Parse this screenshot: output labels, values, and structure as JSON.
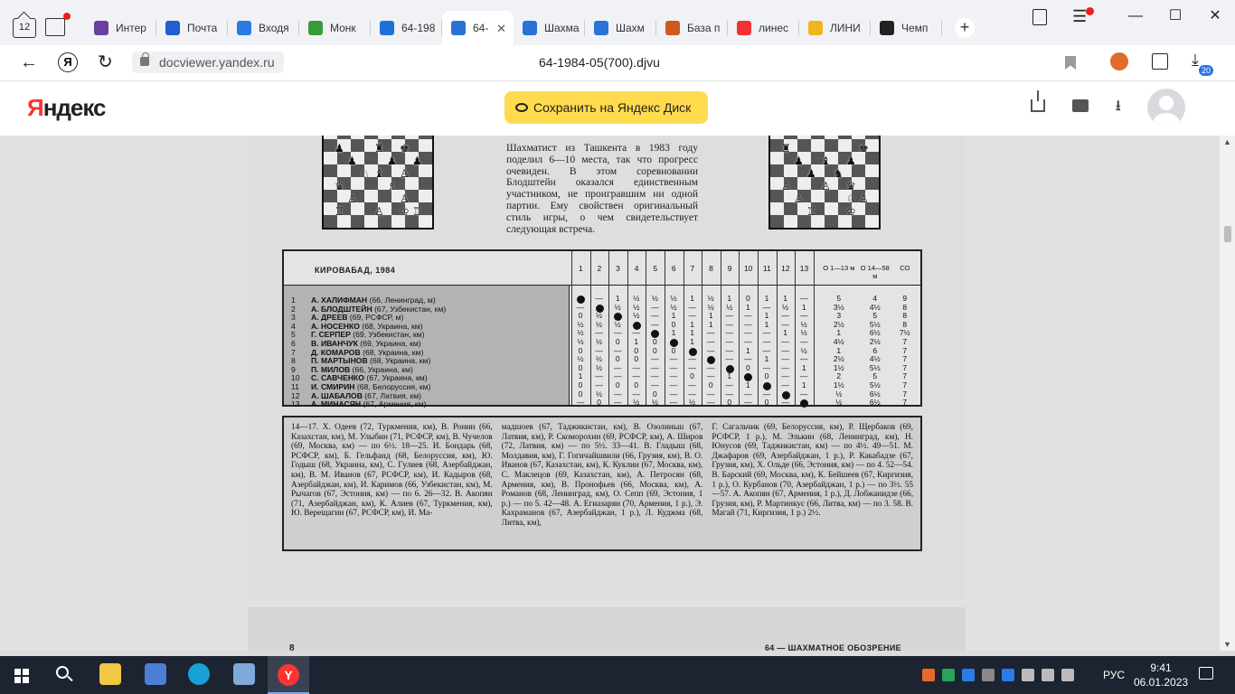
{
  "browser": {
    "tab_count": "12",
    "tabs": [
      {
        "label": "Интер",
        "icon": "rose-icon",
        "color": "#6b3fa0"
      },
      {
        "label": "Почта",
        "icon": "mail-icon",
        "color": "#1f5fcf"
      },
      {
        "label": "Входя",
        "icon": "telegram-check-icon",
        "color": "#2b7be5"
      },
      {
        "label": "Монк",
        "icon": "hd-icon",
        "color": "#3a9a3a"
      },
      {
        "label": "64-198",
        "icon": "edge-doc-icon",
        "color": "#1e6fd9"
      },
      {
        "label": "64-",
        "icon": "document-icon",
        "color": "#2a72d6",
        "active": true
      },
      {
        "label": "Шахма",
        "icon": "document-icon",
        "color": "#2a72d6"
      },
      {
        "label": "Шахм",
        "icon": "document-icon",
        "color": "#2a72d6"
      },
      {
        "label": "База п",
        "icon": "chess-db-icon",
        "color": "#d05a1a"
      },
      {
        "label": "линес",
        "icon": "yandex-icon",
        "color": "#f33333"
      },
      {
        "label": "ЛИНИ",
        "icon": "dots-icon",
        "color": "#f2b51c"
      },
      {
        "label": "Чемп",
        "icon": "wikipedia-icon",
        "color": "#222222"
      }
    ],
    "url": "docviewer.yandex.ru",
    "doc_title": "64-1984-05(700).djvu",
    "downloads_badge": "20"
  },
  "yandex": {
    "logo_ya": "Я",
    "logo_rest": "ндекс",
    "save_button": "Сохранить на Яндекс Диск"
  },
  "article": {
    "text": "Шахматист из Ташкента в 1983 году поделил 6—10 места, так что прогресс очевиден. В этом соревновании Блодштейн оказался единственным участником, не проиграв­шим ни одной партии. Ему свойст­вен оригинальный стиль игры, о чем свидетельствует следующая встреча."
  },
  "crosstable": {
    "title": "КИРОВАБАД, 1984",
    "columns": [
      "1",
      "2",
      "3",
      "4",
      "5",
      "6",
      "7",
      "8",
      "9",
      "10",
      "11",
      "12",
      "13"
    ],
    "o1": "О 1—13 м",
    "o2": "О 14—58 м",
    "co": "СО",
    "rows": [
      {
        "n": "1",
        "name": "А. ХАЛИФМАН",
        "info": "(66, Ленинград, м)",
        "cells": [
          "●",
          "—",
          "1",
          "½",
          "½",
          "½",
          "1",
          "½",
          "1",
          "0",
          "1",
          "1",
          "—"
        ],
        "o1": "5",
        "o2": "4",
        "co": "9"
      },
      {
        "n": "2",
        "name": "А. БЛОДШТЕЙН",
        "info": "(67, Узбекистан, км)",
        "cells": [
          "—",
          "●",
          "½",
          "½",
          "—",
          "½",
          "—",
          "½",
          "½",
          "1",
          "—",
          "½",
          "1"
        ],
        "o1": "3½",
        "o2": "4½",
        "co": "8"
      },
      {
        "n": "3",
        "name": "А. ДРЕЕВ",
        "info": "(69, РСФСР, м)",
        "cells": [
          "0",
          "½",
          "●",
          "½",
          "—",
          "1",
          "—",
          "1",
          "—",
          "—",
          "1",
          "—",
          "—"
        ],
        "o1": "3",
        "o2": "5",
        "co": "8"
      },
      {
        "n": "4",
        "name": "А. НОСЕНКО",
        "info": "(68, Украина, км)",
        "cells": [
          "½",
          "½",
          "½",
          "●",
          "—",
          "0",
          "1",
          "1",
          "—",
          "—",
          "1",
          "—",
          "½"
        ],
        "o1": "2½",
        "o2": "5½",
        "co": "8"
      },
      {
        "n": "5",
        "name": "Г. СЕРПЕР",
        "info": "(69, Узбекистан, км)",
        "cells": [
          "½",
          "—",
          "—",
          "—",
          "●",
          "1",
          "1",
          "—",
          "—",
          "—",
          "—",
          "1",
          "½"
        ],
        "o1": "1",
        "o2": "6½",
        "co": "7½"
      },
      {
        "n": "6",
        "name": "В. ИВАНЧУК",
        "info": "(69, Украина, км)",
        "cells": [
          "½",
          "½",
          "0",
          "1",
          "0",
          "●",
          "1",
          "—",
          "—",
          "—",
          "—",
          "—",
          "—"
        ],
        "o1": "4½",
        "o2": "2½",
        "co": "7"
      },
      {
        "n": "7",
        "name": "Д. КОМАРОВ",
        "info": "(68, Украина, км)",
        "cells": [
          "0",
          "—",
          "—",
          "0",
          "0",
          "0",
          "●",
          "—",
          "—",
          "1",
          "—",
          "—",
          "½"
        ],
        "o1": "1",
        "o2": "6",
        "co": "7"
      },
      {
        "n": "8",
        "name": "П. МАРТЫНОВ",
        "info": "(68, Украина, км)",
        "cells": [
          "½",
          "½",
          "0",
          "0",
          "—",
          "—",
          "—",
          "●",
          "—",
          "—",
          "1",
          "—",
          "—"
        ],
        "o1": "2½",
        "o2": "4½",
        "co": "7"
      },
      {
        "n": "9",
        "name": "П. МИЛОВ",
        "info": "(66, Украина, км)",
        "cells": [
          "0",
          "½",
          "—",
          "—",
          "—",
          "—",
          "—",
          "—",
          "●",
          "0",
          "—",
          "—",
          "1"
        ],
        "o1": "1½",
        "o2": "5½",
        "co": "7"
      },
      {
        "n": "10",
        "name": "С. САВЧЕНКО",
        "info": "(67, Украина, км)",
        "cells": [
          "1",
          "—",
          "—",
          "—",
          "—",
          "—",
          "0",
          "—",
          "1",
          "●",
          "0",
          "—",
          "—"
        ],
        "o1": "2",
        "o2": "5",
        "co": "7"
      },
      {
        "n": "11",
        "name": "И. СМИРИН",
        "info": "(68, Белоруссия, км)",
        "cells": [
          "0",
          "—",
          "0",
          "0",
          "—",
          "—",
          "—",
          "0",
          "—",
          "1",
          "●",
          "—",
          "1"
        ],
        "o1": "1½",
        "o2": "5½",
        "co": "7"
      },
      {
        "n": "12",
        "name": "А. ШАБАЛОВ",
        "info": "(67, Латвия, км)",
        "cells": [
          "0",
          "½",
          "—",
          "—",
          "0",
          "—",
          "—",
          "—",
          "—",
          "—",
          "—",
          "●",
          "—"
        ],
        "o1": "½",
        "o2": "6½",
        "co": "7"
      },
      {
        "n": "13",
        "name": "А. МИНАСЯН",
        "info": "(67, Армения, км)",
        "cells": [
          "—",
          "0",
          "—",
          "½",
          "½",
          "—",
          "½",
          "—",
          "0",
          "—",
          "0",
          "—",
          "●"
        ],
        "o1": "½",
        "o2": "6½",
        "co": "7"
      }
    ]
  },
  "standings": {
    "col1": "14—17. Х. Одеев (72, Туркмения, км), В. Ронин (66, Казахстан, км), М. Улыбин (71, РСФСР, км), В. Чучелов (69, Москва, км) — по 6½. 18—25. И. Бондарь (68, РСФСР, км), Б. Гельфанд (68, Белоруссия, км), Ю. Годыш (68, Украина, км), С. Гулиев (68, Азербайджан, км), В. М. Иванов (67, РСФСР, км), И. Кадыров (68, Азербайджан, км), И. Каримов (66, Узбекистан, км), М. Рычагов (67, Эстония, км) — по 6. 26—32. В. Акопян (71, Азербайджан, км), К. Алиев (67, Туркмения, км), Ю. Верещагин (67, РСФСР, км), И. Ма-",
    "col2": "мадшоев (67, Таджикистан, км), В. Озолиньш (67, Латвия, км), Р. Скоморохин (69, РСФСР, км), А. Широв (72, Латвия, км) — по 5½. 33—41. В. Гладыш (68, Молдавия, км), Г. Гогичайшвили (66, Грузия, км), В. О. Иванов (67, Казахстан, км), К. Куклин (67, Москва, км), С. Маклецов (69, Казахстан, км), А. Петросян (68, Армения, км), В. Пронофьев (66, Москва, км), А. Романов (68, Ленинград, км), О. Сепп (69, Эстония, 1 р.) — по 5. 42—48. А. Егиазарян (70, Армения, 1 р.), Э. Кахраманов (67, Азербайджан, 1 р.), Л. Куджма (68, Литва, км),",
    "col3": "Г. Сагальчик (69, Белоруссия, км), Р. Щербаков (69, РСФСР, 1 р.), М. Эль­кин (68, Ленинград, км), Н. Юнусов (69, Таджикистан, км) — по 4½. 49—51. М. Джафаров (69, Азербайджан, 1 р.), Р. Какабадзе (67, Грузия, км), Х. Ольде (66, Эстония, км) — по 4. 52—54. В. Барский (69, Москва, км), К. Бейшеев (67, Киргизия, 1 р.), О. Курбанов (70, Азербайджан, 1 р.) — по 3½. 55—57. А. Акопян (67, Армения, 1 р.), Д. Лобжанидзе (66, Грузия, км), Р. Мартинкус (66, Литва, км) — по 3. 58. В. Магай (71, Киргизия, 1 р.) 2½."
  },
  "next_page": {
    "number": "8",
    "magazine": "64 — ШАХМАТНОЕ ОБОЗРЕНИЕ"
  },
  "taskbar": {
    "language": "РУС",
    "time": "9:41",
    "date": "06.01.2023"
  }
}
